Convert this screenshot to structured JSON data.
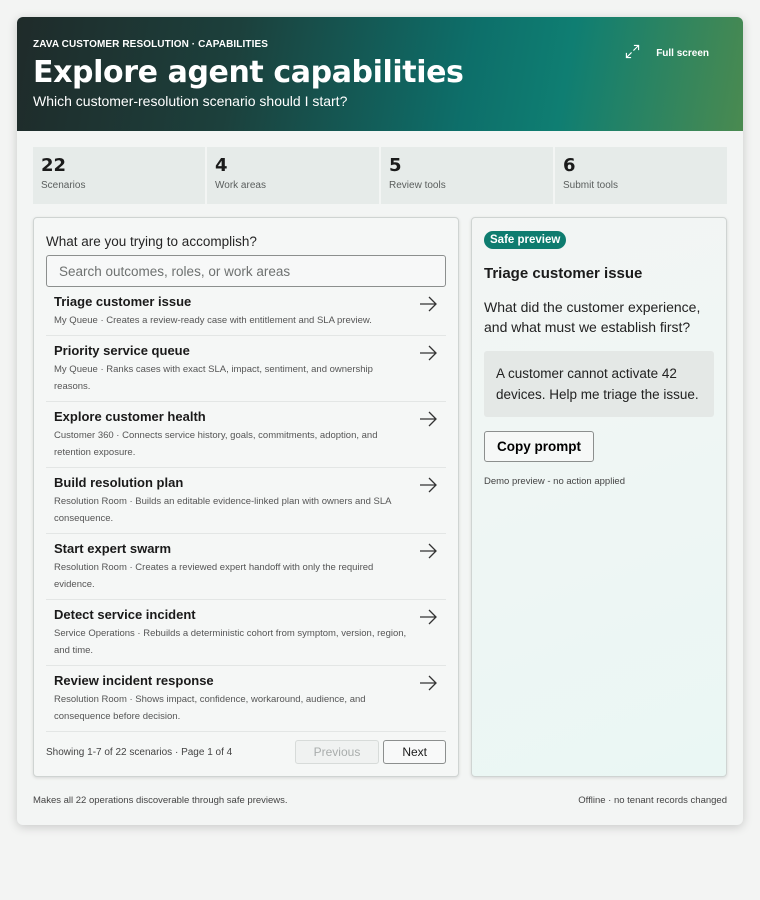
{
  "header": {
    "eyebrow": "ZAVA CUSTOMER RESOLUTION · CAPABILITIES",
    "title": "Explore agent capabilities",
    "subtitle": "Which customer-resolution scenario should I start?",
    "fullscreen_label": "Full screen"
  },
  "stats": [
    {
      "value": "22",
      "label": "Scenarios"
    },
    {
      "value": "4",
      "label": "Work areas"
    },
    {
      "value": "5",
      "label": "Review tools"
    },
    {
      "value": "6",
      "label": "Submit tools"
    }
  ],
  "catalog": {
    "question": "What are you trying to accomplish?",
    "search_placeholder": "Search outcomes, roles, or work areas",
    "items": [
      {
        "title": "Triage customer issue",
        "desc": "My Queue · Creates a review-ready case with entitlement and SLA preview."
      },
      {
        "title": "Priority service queue",
        "desc": "My Queue · Ranks cases with exact SLA, impact, sentiment, and ownership reasons."
      },
      {
        "title": "Explore customer health",
        "desc": "Customer 360 · Connects service history, goals, commitments, adoption, and retention exposure."
      },
      {
        "title": "Build resolution plan",
        "desc": "Resolution Room · Builds an editable evidence-linked plan with owners and SLA consequence."
      },
      {
        "title": "Start expert swarm",
        "desc": "Resolution Room · Creates a reviewed expert handoff with only the required evidence."
      },
      {
        "title": "Detect service incident",
        "desc": "Service Operations · Rebuilds a deterministic cohort from symptom, version, region, and time."
      },
      {
        "title": "Review incident response",
        "desc": "Resolution Room · Shows impact, confidence, workaround, audience, and consequence before decision."
      }
    ],
    "pager_text": "Showing 1-7 of 22 scenarios · Page 1 of 4",
    "previous_label": "Previous",
    "next_label": "Next"
  },
  "preview": {
    "badge": "Safe preview",
    "title": "Triage customer issue",
    "question": "What did the customer experience, and what must we establish first?",
    "prompt": "A customer cannot activate 42 devices. Help me triage the issue.",
    "copy_label": "Copy prompt",
    "note": "Demo preview - no action applied"
  },
  "footer": {
    "left": "Makes all 22 operations discoverable through safe previews.",
    "right": "Offline · no tenant records changed"
  },
  "colors": {
    "accent": "#0e7c6f",
    "header_dark": "#1f2b2a",
    "header_green": "#4a8a50"
  },
  "icons": {
    "fullscreen": "expand-icon",
    "item_arrow": "arrow-right-icon"
  }
}
